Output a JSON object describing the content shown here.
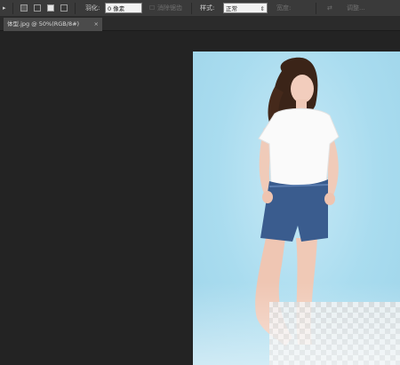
{
  "options": {
    "feather_label": "羽化:",
    "feather_value": "0 像素",
    "antialias_label": "消除锯齿",
    "style_label": "样式:",
    "style_value": "正常",
    "width_label": "宽度:",
    "adjust_edge_label": "调整..."
  },
  "document": {
    "tab_title": "体型.jpg @ 50%(RGB/8#)",
    "close_glyph": "×"
  },
  "colors": {
    "background": "#9fd5ea",
    "top": "#ffffff",
    "shorts": "#3a5c8e",
    "hair": "#3b2418"
  }
}
